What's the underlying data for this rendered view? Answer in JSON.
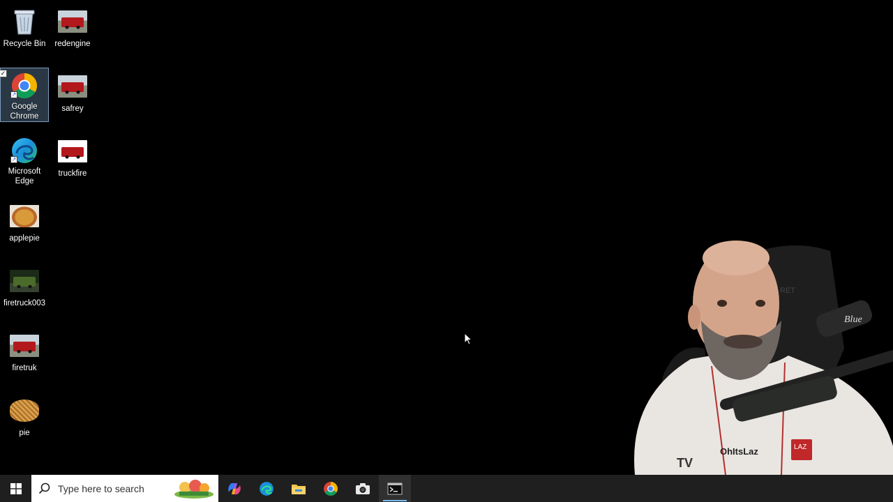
{
  "desktop": {
    "icons": [
      {
        "label": "Recycle Bin",
        "icon": "recycle-bin-icon"
      },
      {
        "label": "redengine",
        "icon": "image-thumbnail-icon"
      },
      {
        "label": "Google Chrome",
        "icon": "chrome-icon"
      },
      {
        "label": "safrey",
        "icon": "image-thumbnail-icon"
      },
      {
        "label": "Microsoft Edge",
        "icon": "edge-icon"
      },
      {
        "label": "truckfire",
        "icon": "image-thumbnail-icon"
      },
      {
        "label": "applepie",
        "icon": "image-thumbnail-icon"
      },
      {
        "label": "firetruck003",
        "icon": "image-thumbnail-icon"
      },
      {
        "label": "firetruk",
        "icon": "image-thumbnail-icon"
      },
      {
        "label": "pie",
        "icon": "image-thumbnail-icon"
      }
    ]
  },
  "webcam": {
    "shirt_text": "OhItsLaz",
    "badge_text": "LAZ",
    "tv_text": "TV",
    "mic_brand": "Blue"
  },
  "taskbar": {
    "search_placeholder": "Type here to search",
    "apps": [
      "copilot-icon",
      "edge-icon",
      "file-explorer-icon",
      "chrome-icon",
      "camera-icon",
      "terminal-icon"
    ]
  }
}
